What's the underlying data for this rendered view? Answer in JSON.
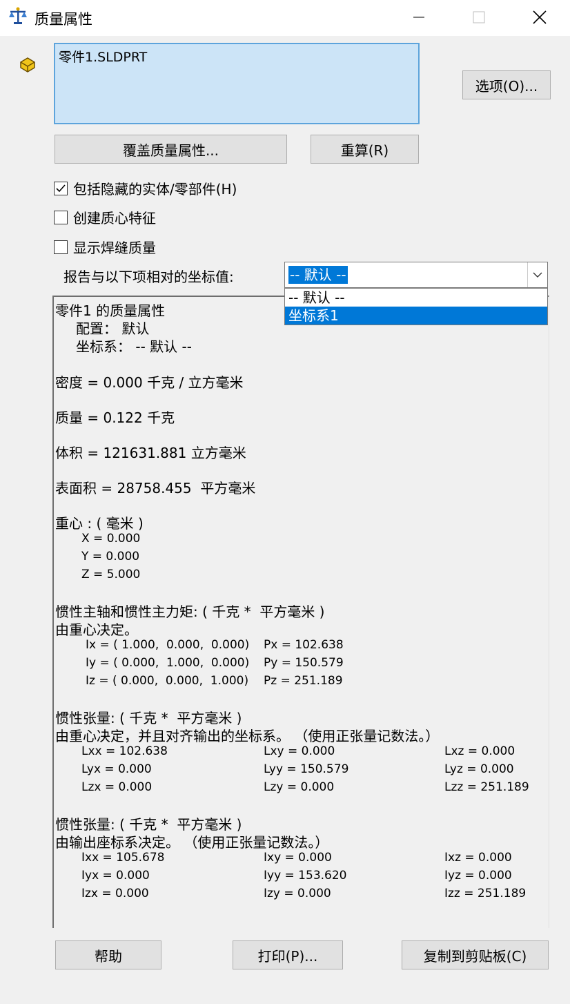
{
  "window": {
    "title": "质量属性",
    "icons": {
      "app": "balance-scale-icon",
      "part": "part-icon"
    }
  },
  "part_list": {
    "item": "零件1.SLDPRT"
  },
  "buttons": {
    "options": "选项(O)...",
    "override": "覆盖质量属性...",
    "recalc": "重算(R)",
    "help": "帮助",
    "print": "打印(P)...",
    "copy": "复制到剪贴板(C)"
  },
  "checkboxes": [
    {
      "label": "包括隐藏的实体/零部件(H)",
      "checked": true
    },
    {
      "label": "创建质心特征",
      "checked": false
    },
    {
      "label": "显示焊缝质量",
      "checked": false
    }
  ],
  "coord": {
    "label": "报告与以下项相对的坐标值:",
    "selected": "-- 默认 --",
    "options": [
      "-- 默认 --",
      "坐标系1"
    ],
    "highlighted_option": 1
  },
  "results": {
    "header": "零件1 的质量属性",
    "config": "配置： 默认",
    "coordsys": "坐标系： -- 默认 --",
    "density": "密度 = 0.000 千克 / 立方毫米",
    "mass": "质量 = 0.122 千克",
    "volume": "体积 = 121631.881 立方毫米",
    "surface_area": "表面积 = 28758.455  平方毫米",
    "center_of_mass": {
      "title": "重心 : ( 毫米 )",
      "lines": [
        "X = 0.000",
        "Y = 0.000",
        "Z = 5.000"
      ]
    },
    "principal": {
      "title": "惯性主轴和惯性主力矩: ( 千克 *  平方毫米 )",
      "subtitle": "由重心决定。",
      "axes": [
        "Ix = ( 1.000,  0.000,  0.000)",
        "Iy = ( 0.000,  1.000,  0.000)",
        "Iz = ( 0.000,  0.000,  1.000)"
      ],
      "moments": [
        "Px = 102.638",
        "Py = 150.579",
        "Pz = 251.189"
      ]
    },
    "tensor_cm": {
      "title": "惯性张量: ( 千克 *  平方毫米 )",
      "subtitle": "由重心决定，并且对齐输出的坐标系。 （使用正张量记数法。）",
      "rows": [
        [
          "Lxx = 102.638",
          "Lxy = 0.000",
          "Lxz = 0.000"
        ],
        [
          "Lyx = 0.000",
          "Lyy = 150.579",
          "Lyz = 0.000"
        ],
        [
          "Lzx = 0.000",
          "Lzy = 0.000",
          "Lzz = 251.189"
        ]
      ]
    },
    "tensor_out": {
      "title": "惯性张量: ( 千克 *  平方毫米 )",
      "subtitle": "由输出座标系决定。 （使用正张量记数法。）",
      "rows": [
        [
          "Ixx = 105.678",
          "Ixy = 0.000",
          "Ixz = 0.000"
        ],
        [
          "Iyx = 0.000",
          "Iyy = 153.620",
          "Iyz = 0.000"
        ],
        [
          "Izx = 0.000",
          "Izy = 0.000",
          "Izz = 251.189"
        ]
      ]
    }
  }
}
